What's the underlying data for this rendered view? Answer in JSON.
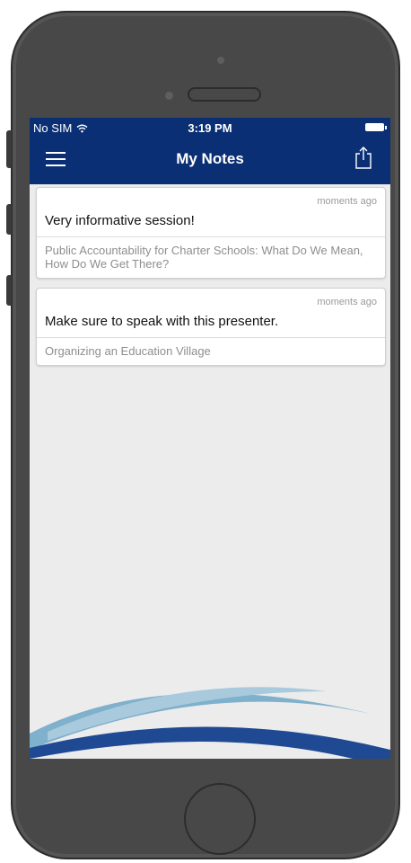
{
  "status_bar": {
    "carrier": "No SIM",
    "time": "3:19 PM"
  },
  "nav": {
    "title": "My Notes",
    "menu_icon": "hamburger-menu-icon",
    "share_icon": "share-icon"
  },
  "notes": [
    {
      "timestamp": "moments ago",
      "text": "Very informative session!",
      "session": "Public Accountability for Charter Schools: What Do We Mean, How Do We Get There?"
    },
    {
      "timestamp": "moments ago",
      "text": "Make sure to speak with this presenter.",
      "session": "Organizing an Education Village"
    }
  ],
  "colors": {
    "nav_background": "#0b2f74",
    "screen_background": "#ececec",
    "device_body": "#484848"
  }
}
